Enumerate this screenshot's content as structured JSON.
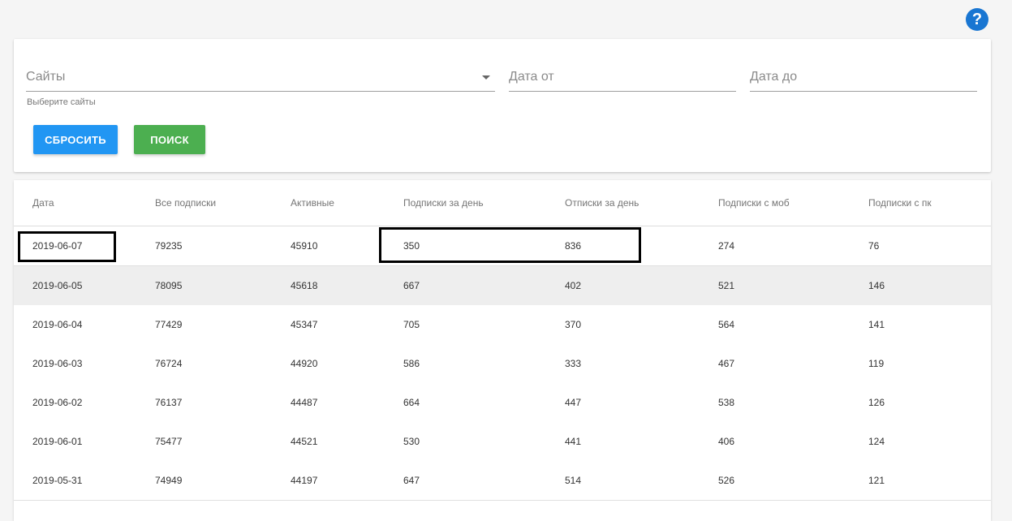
{
  "help": {
    "icon": "help-icon",
    "label": "?"
  },
  "filters": {
    "sites_label": "Сайты",
    "sites_helper": "Выберите сайты",
    "date_from_label": "Дата от",
    "date_to_label": "Дата до",
    "reset_label": "СБРОСИТЬ",
    "search_label": "ПОИСК"
  },
  "colors": {
    "reset": "#2196f3",
    "search": "#4caf50",
    "help": "#1976d2",
    "highlight_row": "#eeeeee"
  },
  "table": {
    "headers": [
      "Дата",
      "Все подписки",
      "Активные",
      "Подписки за день",
      "Отписки за день",
      "Подписки с моб",
      "Подписки с пк"
    ],
    "rows": [
      [
        "2019-06-07",
        "79235",
        "45910",
        "350",
        "836",
        "274",
        "76"
      ],
      [
        "2019-06-05",
        "78095",
        "45618",
        "667",
        "402",
        "521",
        "146"
      ],
      [
        "2019-06-04",
        "77429",
        "45347",
        "705",
        "370",
        "564",
        "141"
      ],
      [
        "2019-06-03",
        "76724",
        "44920",
        "586",
        "333",
        "467",
        "119"
      ],
      [
        "2019-06-02",
        "76137",
        "44487",
        "664",
        "447",
        "538",
        "126"
      ],
      [
        "2019-06-01",
        "75477",
        "44521",
        "530",
        "441",
        "406",
        "124"
      ],
      [
        "2019-05-31",
        "74949",
        "44197",
        "647",
        "514",
        "526",
        "121"
      ]
    ]
  }
}
